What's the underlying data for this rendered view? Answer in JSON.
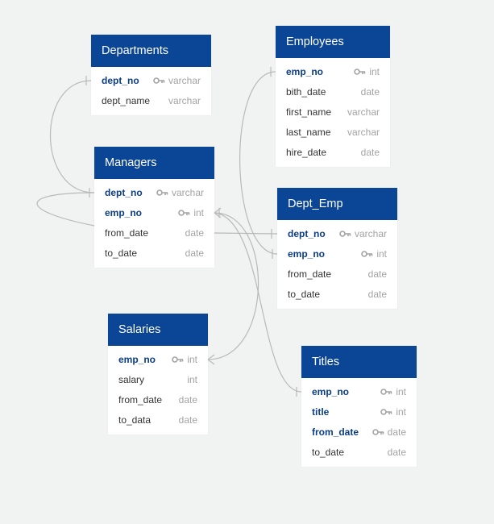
{
  "colors": {
    "header": "#0b4595",
    "pk_text": "#0b3d86",
    "type_text": "#a3a3a3",
    "edge": "#b9b9b9"
  },
  "tables": {
    "departments": {
      "title": "Departments",
      "fields": [
        {
          "name": "dept_no",
          "type": "varchar",
          "pk": true
        },
        {
          "name": "dept_name",
          "type": "varchar",
          "pk": false
        }
      ]
    },
    "employees": {
      "title": "Employees",
      "fields": [
        {
          "name": "emp_no",
          "type": "int",
          "pk": true
        },
        {
          "name": "bith_date",
          "type": "date",
          "pk": false
        },
        {
          "name": "first_name",
          "type": "varchar",
          "pk": false
        },
        {
          "name": "last_name",
          "type": "varchar",
          "pk": false
        },
        {
          "name": "hire_date",
          "type": "date",
          "pk": false
        }
      ]
    },
    "managers": {
      "title": "Managers",
      "fields": [
        {
          "name": "dept_no",
          "type": "varchar",
          "pk": true
        },
        {
          "name": "emp_no",
          "type": "int",
          "pk": true
        },
        {
          "name": "from_date",
          "type": "date",
          "pk": false
        },
        {
          "name": "to_date",
          "type": "date",
          "pk": false
        }
      ]
    },
    "dept_emp": {
      "title": "Dept_Emp",
      "fields": [
        {
          "name": "dept_no",
          "type": "varchar",
          "pk": true
        },
        {
          "name": "emp_no",
          "type": "int",
          "pk": true
        },
        {
          "name": "from_date",
          "type": "date",
          "pk": false
        },
        {
          "name": "to_date",
          "type": "date",
          "pk": false
        }
      ]
    },
    "salaries": {
      "title": "Salaries",
      "fields": [
        {
          "name": "emp_no",
          "type": "int",
          "pk": true
        },
        {
          "name": "salary",
          "type": "int",
          "pk": false
        },
        {
          "name": "from_date",
          "type": "date",
          "pk": false
        },
        {
          "name": "to_data",
          "type": "date",
          "pk": false
        }
      ]
    },
    "titles": {
      "title": "Titles",
      "fields": [
        {
          "name": "emp_no",
          "type": "int",
          "pk": true
        },
        {
          "name": "title",
          "type": "int",
          "pk": true
        },
        {
          "name": "from_date",
          "type": "date",
          "pk": true
        },
        {
          "name": "to_date",
          "type": "date",
          "pk": false
        }
      ]
    }
  }
}
